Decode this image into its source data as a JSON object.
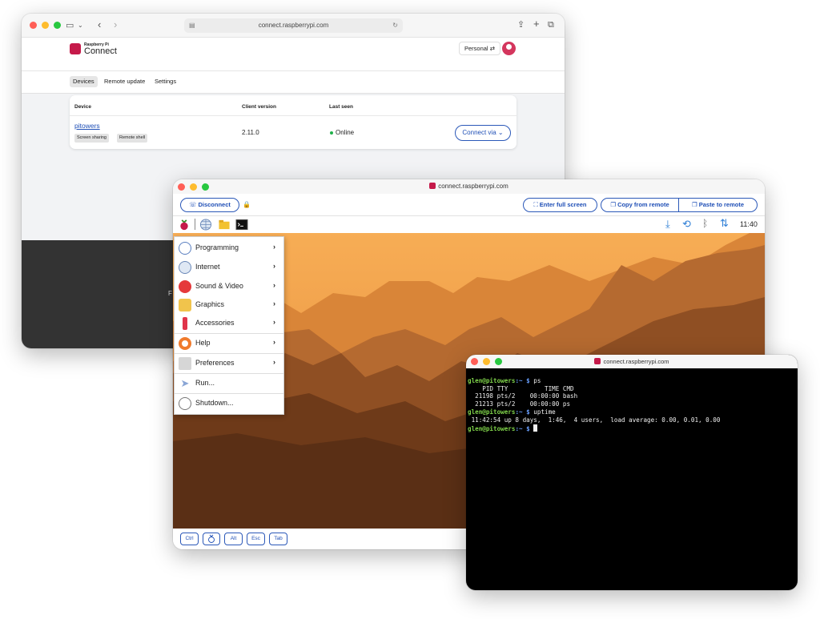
{
  "browser": {
    "url": "connect.raspberrypi.com",
    "brand_small": "Raspberry Pi",
    "brand": "Connect",
    "account_label": "Personal",
    "tabs": [
      {
        "label": "Devices",
        "active": true
      },
      {
        "label": "Remote update",
        "active": false
      },
      {
        "label": "Settings",
        "active": false
      }
    ],
    "table": {
      "headers": {
        "device": "Device",
        "client_version": "Client version",
        "last_seen": "Last seen"
      },
      "rows": [
        {
          "device": "pitowers",
          "tags": [
            "Screen sharing",
            "Remote shell"
          ],
          "client_version": "2.11.0",
          "last_seen": "Online",
          "action": "Connect via"
        }
      ]
    },
    "footer_partial": "F"
  },
  "remote": {
    "title": "connect.raspberrypi.com",
    "disconnect_label": "Disconnect",
    "full_screen_label": "Enter full screen",
    "copy_label": "Copy from remote",
    "paste_label": "Paste to remote",
    "clock": "11:40",
    "menu": {
      "items": [
        {
          "label": "Programming",
          "icon": "programming-icon",
          "submenu": true
        },
        {
          "label": "Internet",
          "icon": "globe-icon",
          "submenu": true
        },
        {
          "label": "Sound & Video",
          "icon": "media-play-icon",
          "submenu": true
        },
        {
          "label": "Graphics",
          "icon": "paint-icon",
          "submenu": true
        },
        {
          "label": "Accessories",
          "icon": "knife-icon",
          "submenu": true
        },
        {
          "label": "Help",
          "icon": "lifebuoy-icon",
          "submenu": true
        },
        {
          "label": "Preferences",
          "icon": "sliders-icon",
          "submenu": true
        },
        {
          "label": "Run...",
          "icon": "paper-plane-icon",
          "submenu": false
        },
        {
          "label": "Shutdown...",
          "icon": "power-icon",
          "submenu": false
        }
      ]
    },
    "keys": [
      "Ctrl",
      "Alt",
      "Esc",
      "Tab"
    ]
  },
  "terminal": {
    "title": "connect.raspberrypi.com",
    "prompt_user": "glen@pitowers",
    "prompt_path": ":~ $",
    "lines": [
      {
        "type": "prompt",
        "cmd": " ps"
      },
      {
        "type": "out",
        "text": "    PID TTY          TIME CMD"
      },
      {
        "type": "out",
        "text": "  21198 pts/2    00:00:00 bash"
      },
      {
        "type": "out",
        "text": "  21213 pts/2    00:00:00 ps"
      },
      {
        "type": "prompt",
        "cmd": " uptime"
      },
      {
        "type": "out",
        "text": " 11:42:54 up 8 days,  1:46,  4 users,  load average: 0.00, 0.01, 0.00"
      },
      {
        "type": "prompt",
        "cmd": " "
      }
    ]
  },
  "colors": {
    "accent_blue": "#1f4fb6",
    "raspberry_red": "#c51a4a",
    "online_green": "#20b14a",
    "prompt_green": "#7fd34a",
    "prompt_blue": "#6aa0ff"
  }
}
